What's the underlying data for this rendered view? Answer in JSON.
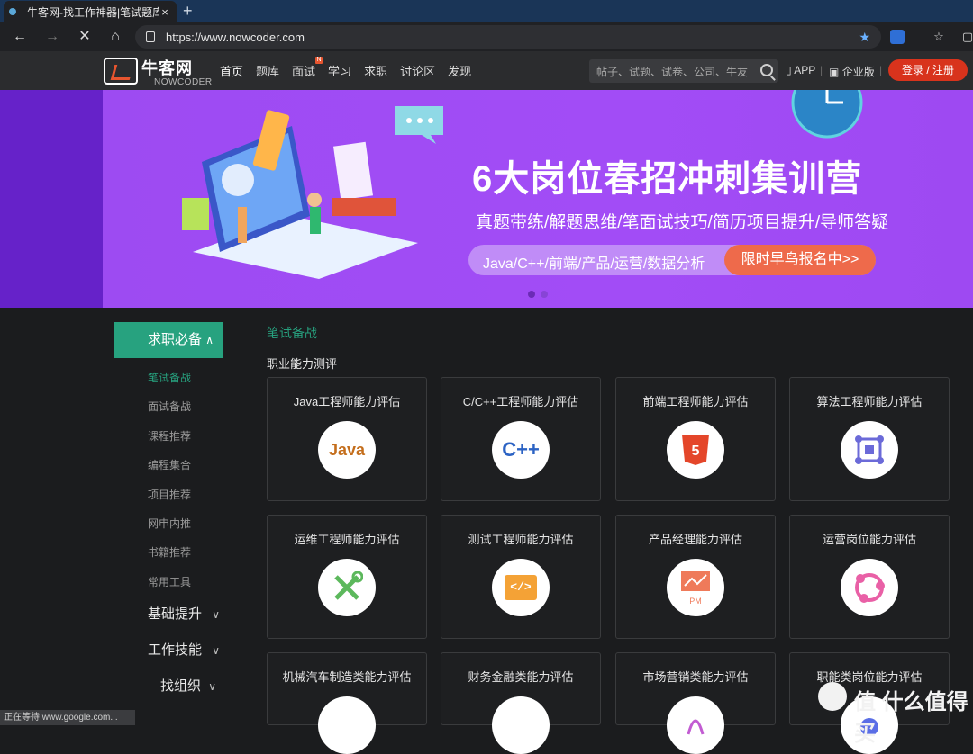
{
  "browser": {
    "tab_title": "牛客网-找工作神器|笔试题库|面试",
    "tab_close": "×",
    "new_tab": "+",
    "url": "https://www.nowcoder.com",
    "status": "正在等待 www.google.com..."
  },
  "header": {
    "logo_name": "牛客网",
    "logo_sub": "NOWCODER",
    "nav": [
      "首页",
      "题库",
      "面试",
      "学习",
      "求职",
      "讨论区",
      "发现"
    ],
    "nav_badge": "N",
    "search_placeholder": "帖子、试题、试卷、公司、牛友",
    "app_label": "APP",
    "enterprise_label": "企业版",
    "login_label": "登录 / 注册"
  },
  "banner": {
    "title": "6大岗位春招冲刺集训营",
    "subtitle": "真题带练/解题思维/笔面试技巧/简历项目提升/导师答疑",
    "pill_left": "Java/C++/前端/产品/运营/数据分析",
    "pill_right": "限时早鸟报名中>>"
  },
  "sidebar": {
    "active": "求职必备",
    "subitems": [
      "笔试备战",
      "面试备战",
      "课程推荐",
      "编程集合",
      "项目推荐",
      "网申内推",
      "书籍推荐",
      "常用工具"
    ],
    "groups": [
      "基础提升",
      "工作技能",
      "找组织"
    ]
  },
  "content": {
    "section_title": "笔试备战",
    "subsection_title": "职业能力测评",
    "cards": [
      {
        "title": "Java工程师能力评估",
        "icon": "java-icon",
        "glyph": "Java"
      },
      {
        "title": "C/C++工程师能力评估",
        "icon": "cpp-icon",
        "glyph": "C++"
      },
      {
        "title": "前端工程师能力评估",
        "icon": "html5-icon",
        "glyph": "5"
      },
      {
        "title": "算法工程师能力评估",
        "icon": "algorithm-icon",
        "glyph": ""
      },
      {
        "title": "运维工程师能力评估",
        "icon": "tools-icon",
        "glyph": ""
      },
      {
        "title": "测试工程师能力评估",
        "icon": "code-icon",
        "glyph": "</>"
      },
      {
        "title": "产品经理能力评估",
        "icon": "presentation-icon",
        "glyph": "PM"
      },
      {
        "title": "运营岗位能力评估",
        "icon": "network-icon",
        "glyph": ""
      },
      {
        "title": "机械汽车制造类能力评估",
        "icon": "machine-icon",
        "glyph": ""
      },
      {
        "title": "财务金融类能力评估",
        "icon": "finance-icon",
        "glyph": ""
      },
      {
        "title": "市场营销类能力评估",
        "icon": "marketing-icon",
        "glyph": ""
      },
      {
        "title": "职能类岗位能力评估",
        "icon": "function-icon",
        "glyph": ""
      }
    ]
  },
  "watermark": "值 什么值得买",
  "colors": {
    "accent": "#27a27f",
    "brand_red": "#d8331c",
    "banner": "#a24cf6"
  }
}
